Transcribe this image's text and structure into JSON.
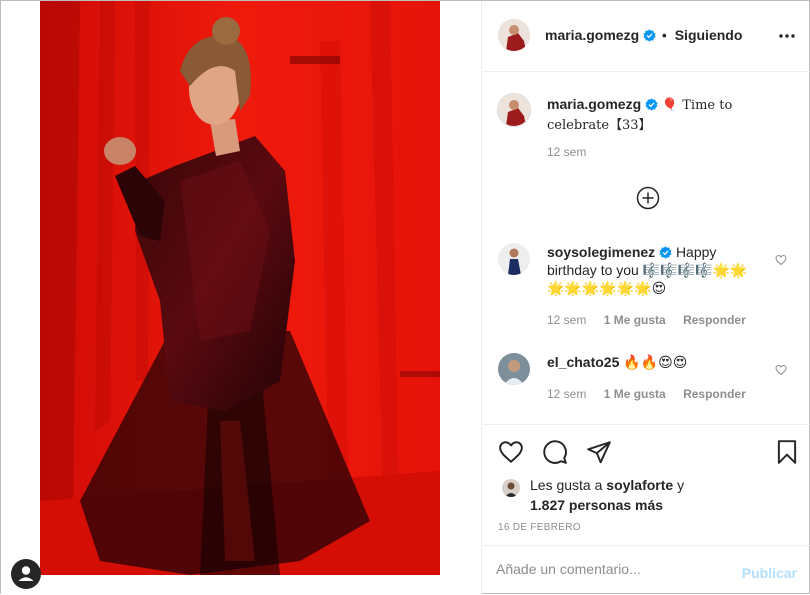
{
  "post": {
    "author": "maria.gomezg",
    "follow_label": "Siguiendo",
    "separator": "•",
    "caption_username": "maria.gomezg",
    "caption_text": "🎈 Time to celebrate【33】",
    "caption_time": "12 sem",
    "comments": [
      {
        "username": "soysolegimenez",
        "text": "Happy birthday to you 🎼🎼🎼🎼🌟🌟🌟🌟🌟🌟🌟🌟😍",
        "time": "12 sem",
        "likes": "1 Me gusta",
        "reply": "Responder"
      },
      {
        "username": "el_chato25",
        "text": "🔥🔥😍😍",
        "time": "12 sem",
        "likes": "1 Me gusta",
        "reply": "Responder"
      }
    ],
    "likes_prefix": "Les gusta a",
    "likes_user": "soylaforte",
    "likes_suffix": "y",
    "likes_others": "1.827 personas más",
    "date": "16 DE FEBRERO"
  },
  "add_comment": {
    "placeholder": "Añade un comentario...",
    "publish_label": "Publicar"
  },
  "icons": {
    "more": "more-horizontal-icon",
    "load_more": "plus-circle-icon",
    "like": "heart-icon",
    "comment": "comment-icon",
    "share": "paper-plane-icon",
    "save": "bookmark-icon",
    "verified": "verified-badge-icon",
    "profile": "user-profile-icon"
  },
  "colors": {
    "accent_blue": "#0095f6",
    "publish_disabled": "#b2dffc",
    "photo_red": "#e00d07",
    "secondary_text": "#8e8e8e"
  }
}
